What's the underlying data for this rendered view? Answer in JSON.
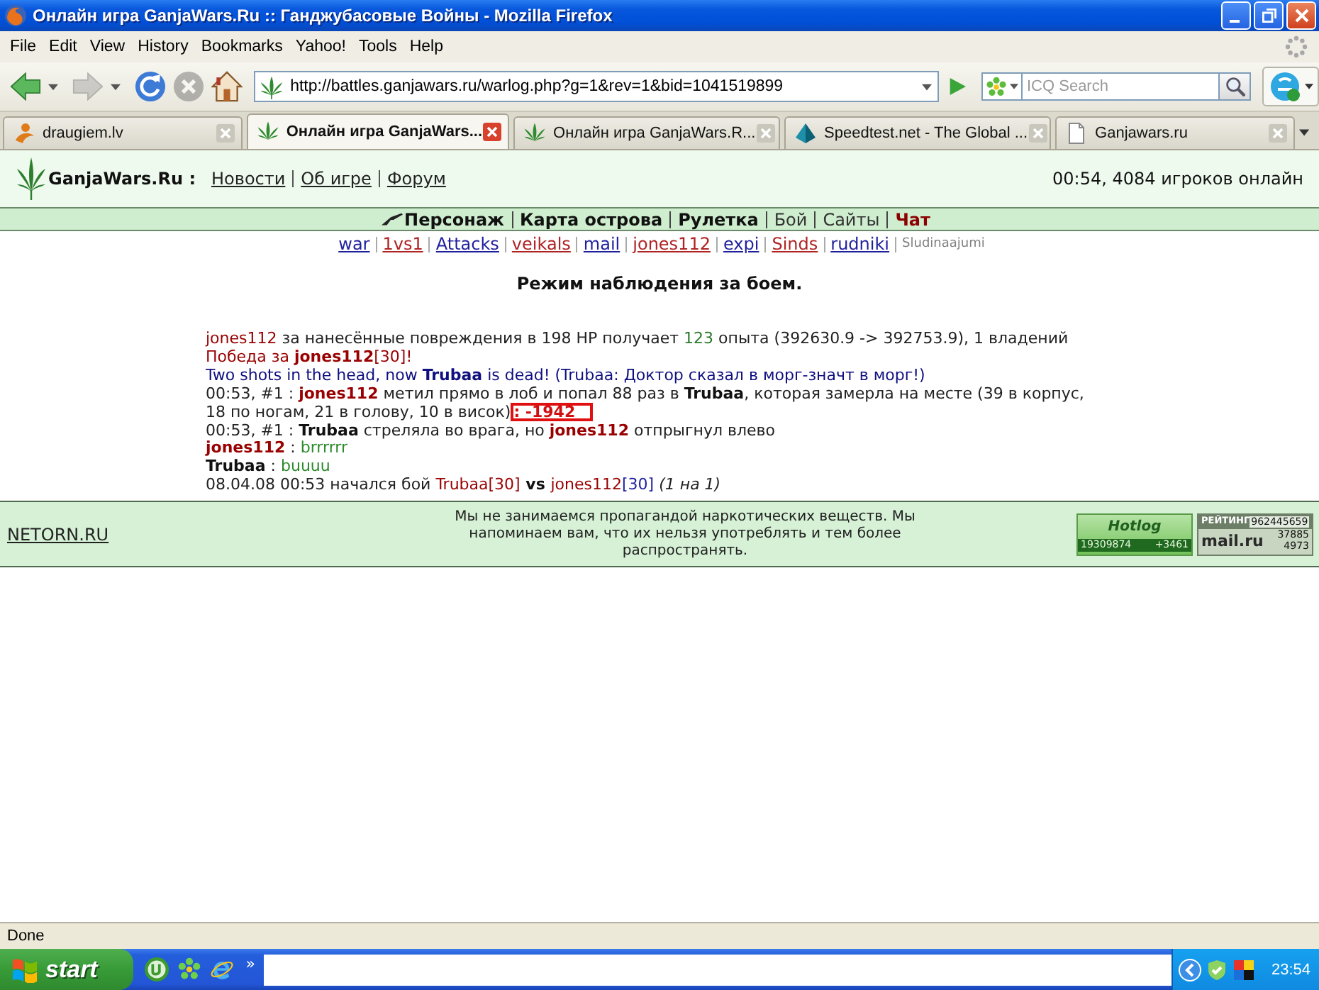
{
  "window": {
    "title": "Онлайн игра GanjaWars.Ru :: Ганджубасовые Войны - Mozilla Firefox"
  },
  "menu": [
    "File",
    "Edit",
    "View",
    "History",
    "Bookmarks",
    "Yahoo!",
    "Tools",
    "Help"
  ],
  "nav_buttons": [
    {
      "kind": "back",
      "disabled": false
    },
    {
      "kind": "forward",
      "disabled": true
    },
    {
      "kind": "reload",
      "disabled": false
    },
    {
      "kind": "stop",
      "disabled": true
    },
    {
      "kind": "home",
      "disabled": false
    }
  ],
  "toolbar": {
    "url": "http://battles.ganjawars.ru/warlog.php?g=1&rev=1&bid=1041519899",
    "search": {
      "placeholder": "ICQ Search"
    }
  },
  "tabs": [
    {
      "label": "draugiem.lv",
      "kind": "person",
      "selected": false
    },
    {
      "label": "Онлайн игра GanjaWars...",
      "kind": "leaf",
      "selected": true
    },
    {
      "label": "Онлайн игра GanjaWars.R...",
      "kind": "leaf",
      "selected": false
    },
    {
      "label": "Speedtest.net - The Global ...",
      "kind": "pyramid",
      "selected": false
    },
    {
      "label": "Ganjawars.ru",
      "kind": "page",
      "selected": false
    }
  ],
  "page": {
    "logo": "GanjaWars.Ru :",
    "links": [
      "Новости",
      "Об игре",
      "Форум"
    ],
    "online": "00:54, 4084 игроков онлайн",
    "main_nav": [
      {
        "label": "Персонаж",
        "kind": "main"
      },
      {
        "label": "Карта острова",
        "kind": "main"
      },
      {
        "label": "Рулетка",
        "kind": "main"
      },
      {
        "label": "Бой",
        "kind": "plain"
      },
      {
        "label": "Сайты",
        "kind": "plain"
      },
      {
        "label": "Чат",
        "kind": "alert"
      }
    ],
    "forums": [
      {
        "label": "war",
        "kind": "link",
        "color": "#1f1f9e"
      },
      {
        "label": "1vs1",
        "kind": "link",
        "color": "#b02323"
      },
      {
        "label": "Attacks",
        "kind": "link",
        "color": "#1f1f9e"
      },
      {
        "label": "veikals",
        "kind": "link",
        "color": "#b02323"
      },
      {
        "label": "mail",
        "kind": "link",
        "color": "#1f1f9e"
      },
      {
        "label": "jones112",
        "kind": "link",
        "color": "#b02323"
      },
      {
        "label": "expi",
        "kind": "link",
        "color": "#1f1f9e"
      },
      {
        "label": "Sinds",
        "kind": "link",
        "color": "#b02323"
      },
      {
        "label": "rudniki",
        "kind": "link",
        "color": "#1f1f9e"
      },
      {
        "label": "Sludinaajumi",
        "kind": "text",
        "color": "#808080"
      }
    ],
    "heading": "Режим наблюдения за боем.",
    "log": [
      [
        {
          "kind": "player",
          "text": "jones112"
        },
        {
          "kind": "text",
          "text": " за нанесённые повреждения в 198 HP получает "
        },
        {
          "kind": "num",
          "text": "123"
        },
        {
          "kind": "text",
          "text": " опыта (392630.9 -> 392753.9), 1 владений"
        }
      ],
      [
        {
          "kind": "win",
          "text": "Победа за **jones112**[30]!"
        }
      ],
      [
        {
          "kind": "death",
          "text": "Two shots in the head, now **Trubaa** is dead! (Trubaa: Доктор сказал в морг-значт в морг!)"
        }
      ],
      [
        {
          "kind": "text",
          "text": "00:53, #1 : "
        },
        {
          "kind": "hero",
          "text": "jones112"
        },
        {
          "kind": "text",
          "text": " метил прямо в лоб и попал 88 раз в "
        },
        {
          "kind": "foe",
          "text": "Trubaa"
        },
        {
          "kind": "text",
          "text": ", которая замерла на месте (39 в корпус, 18 по ногам, 21 в голову, 10 в висок)"
        },
        {
          "kind": "damage",
          "text": ": -1942"
        }
      ],
      [
        {
          "kind": "text",
          "text": "00:53, #1 : "
        },
        {
          "kind": "foe",
          "text": "Trubaa"
        },
        {
          "kind": "text",
          "text": " стреляла во врага, но "
        },
        {
          "kind": "hero",
          "text": "jones112"
        },
        {
          "kind": "text",
          "text": " отпрыгнул влево"
        }
      ],
      [
        {
          "kind": "hero",
          "text": "jones112"
        },
        {
          "kind": "text",
          "text": " : "
        },
        {
          "kind": "speech",
          "text": "brrrrrr"
        }
      ],
      [
        {
          "kind": "foe",
          "text": "Trubaa"
        },
        {
          "kind": "text",
          "text": " : "
        },
        {
          "kind": "speech",
          "text": "buuuu"
        }
      ],
      [
        {
          "kind": "text",
          "text": "08.04.08 00:53 начался бой "
        },
        {
          "kind": "player",
          "text": "Trubaa[30]"
        },
        {
          "kind": "versus",
          "text": " vs "
        },
        {
          "kind": "player",
          "text": "jones112"
        },
        {
          "kind": "team",
          "text": "[30]"
        },
        {
          "kind": "note",
          "text": " (1 на 1)"
        }
      ]
    ],
    "footer": {
      "link": "NETORN.RU",
      "notice": "Мы не занимаемся пропагандой наркотических веществ. Мы напоминаем вам, что их нельзя употреблять и тем более распространять.",
      "counters": [
        {
          "kind": "hotlog",
          "logo": "Hotlog",
          "total": "19309874",
          "today": "+3461"
        },
        {
          "kind": "rating",
          "label": "РЕЙТИНГ",
          "number": "962445659",
          "logo": "mail.ru",
          "total": "37885",
          "today": "4973"
        }
      ]
    }
  },
  "status": "Done",
  "taskbar": {
    "start": "start",
    "more": "»",
    "clock": "23:54"
  }
}
